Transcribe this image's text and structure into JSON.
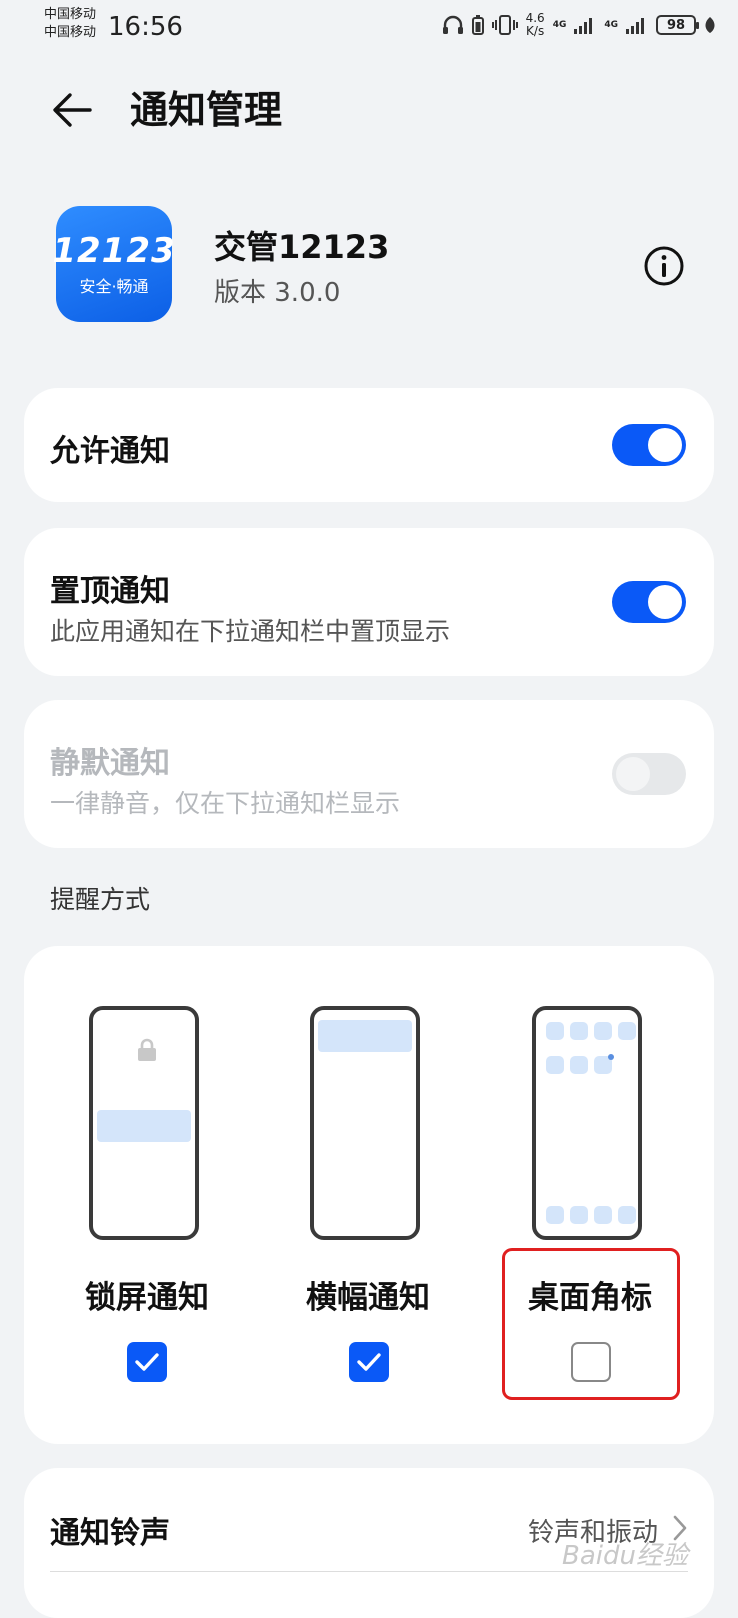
{
  "status_bar": {
    "carrier1": "中国移动",
    "carrier2": "中国移动",
    "time": "16:56",
    "speed_value": "4.6",
    "speed_unit": "K/s",
    "net1": "4G",
    "net2": "4G",
    "battery": "98"
  },
  "header": {
    "title": "通知管理"
  },
  "app": {
    "name": "交管12123",
    "version": "版本 3.0.0",
    "icon_number": "12123",
    "icon_slogan": "安全·畅通"
  },
  "settings": {
    "allow": {
      "title": "允许通知",
      "enabled": true
    },
    "pinned": {
      "title": "置顶通知",
      "subtitle": "此应用通知在下拉通知栏中置顶显示",
      "enabled": true
    },
    "silent": {
      "title": "静默通知",
      "subtitle": "一律静音，仅在下拉通知栏显示",
      "enabled": false
    }
  },
  "reminder": {
    "section_label": "提醒方式",
    "styles": [
      {
        "label": "锁屏通知",
        "checked": true
      },
      {
        "label": "横幅通知",
        "checked": true
      },
      {
        "label": "桌面角标",
        "checked": false
      }
    ]
  },
  "ringtone": {
    "title": "通知铃声",
    "value": "铃声和振动"
  },
  "watermark": "Baidu经验",
  "colors": {
    "accent": "#0a59f7",
    "highlight": "#e02020",
    "background": "#f1f3f5"
  }
}
